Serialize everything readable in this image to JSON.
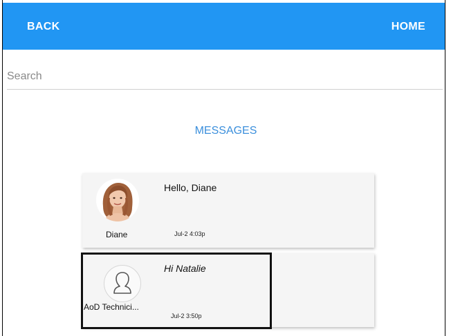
{
  "topbar": {
    "back_label": "BACK",
    "home_label": "HOME",
    "color": "#2196f3"
  },
  "search": {
    "placeholder": "Search",
    "value": ""
  },
  "section": {
    "title": "MESSAGES",
    "color": "#3b8fdc"
  },
  "messages": [
    {
      "sender": "Diane",
      "text": "Hello, Diane",
      "time": "Jul-2 4:03p",
      "avatar": "photo"
    },
    {
      "sender": "AoD Technici...",
      "text": "Hi Natalie",
      "time": "Jul-2 3:50p",
      "avatar": "person-outline-icon"
    }
  ]
}
